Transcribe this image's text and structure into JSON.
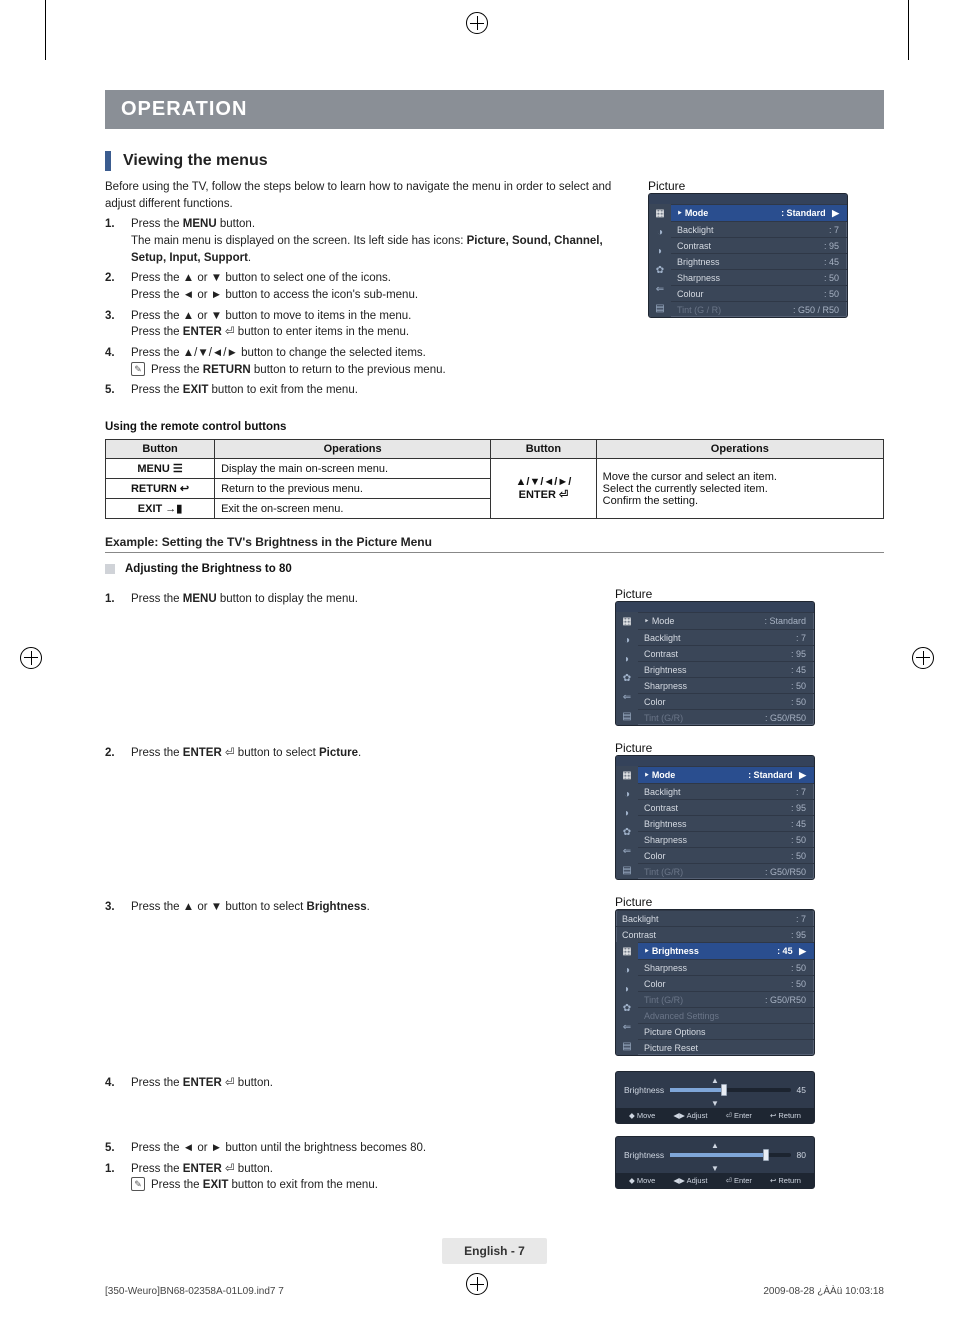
{
  "chapter": "OPERATION",
  "section": "Viewing the menus",
  "intro": "Before using the TV, follow the steps below to learn how to navigate the menu in order to select and adjust different functions.",
  "steps_main": [
    {
      "text": "Press the MENU button.",
      "sub": "The main menu is displayed on the screen. Its left side has icons: Picture, Sound, Channel, Setup, Input, Support."
    },
    {
      "text": "Press the ▲ or ▼ button to select one of the icons.",
      "sub": "Press the ◄ or ► button to access the icon's sub-menu."
    },
    {
      "text": "Press the ▲ or ▼ button to move to items in the menu.",
      "sub": "Press the ENTER button to enter items in the menu."
    },
    {
      "text": "Press the ▲/▼/◄/► button to change the selected items.",
      "note": "Press the RETURN button to return to the previous menu."
    },
    {
      "text": "Press the EXIT button to exit from the menu."
    }
  ],
  "remote_header": "Using the remote control buttons",
  "table": {
    "headers": [
      "Button",
      "Operations",
      "Button",
      "Operations"
    ],
    "rows_left": [
      {
        "btn": "MENU ☰",
        "op": "Display the main on-screen menu."
      },
      {
        "btn": "RETURN ↩",
        "op": "Return to the previous menu."
      },
      {
        "btn": "EXIT →▮",
        "op": "Exit the on-screen menu."
      }
    ],
    "right_btn": "▲/▼/◄/►/\nENTER ⏎",
    "right_ops": [
      "Move the cursor and select an item.",
      "Select the currently selected item.",
      "Confirm the setting."
    ]
  },
  "example_hd": "Example: Setting the TV's Brightness in the Picture Menu",
  "adjusting_hd": "Adjusting the Brightness to 80",
  "example_steps": {
    "s1": "Press the MENU button to display the menu.",
    "s2": "Press the ENTER ⏎ button to select Picture.",
    "s3": "Press the ▲ or ▼ button to select Brightness.",
    "s4": "Press the ENTER ⏎ button.",
    "s5": "Press the ◄ or ► button until the brightness becomes 80.",
    "s6": "Press the ENTER ⏎ button.",
    "s6note": "Press the EXIT button to exit from the menu."
  },
  "osd_items": {
    "mode_label": "Mode",
    "mode_value": ": Standard",
    "backlight": "Backlight",
    "backlight_v": ": 7",
    "contrast": "Contrast",
    "contrast_v": ": 95",
    "brightness": "Brightness",
    "brightness_v": ": 45",
    "sharpness": "Sharpness",
    "sharpness_v": ": 50",
    "colour": "Colour",
    "colour_v": ": 50",
    "color": "Color",
    "color_v": ": 50",
    "tint": "Tint (G / R)",
    "tint_v": ": G50 / R50",
    "tint2": "Tint (G/R)",
    "tint2_v": ": G50/R50",
    "adv": "Advanced Settings",
    "popt": "Picture Options",
    "preset": "Picture Reset",
    "picture_label": "Picture"
  },
  "slider": {
    "label": "Brightness",
    "v45": "45",
    "v80": "80",
    "move": "Move",
    "adjust": "Adjust",
    "enter": "Enter",
    "return": "Return"
  },
  "page_footer": "English - 7",
  "doc_footer_left": "[350-Weuro]BN68-02358A-01L09.ind7   7",
  "doc_footer_right": "2009-08-28   ¿ÀÀü 10:03:18",
  "icons": {
    "up": "▲",
    "down": "▼",
    "left": "◄",
    "right": "►",
    "enter": "⏎",
    "return": "↩",
    "exit": "→▮",
    "menu": "☰",
    "note": "✎",
    "updown": "◆",
    "leftright": "◀▶"
  }
}
